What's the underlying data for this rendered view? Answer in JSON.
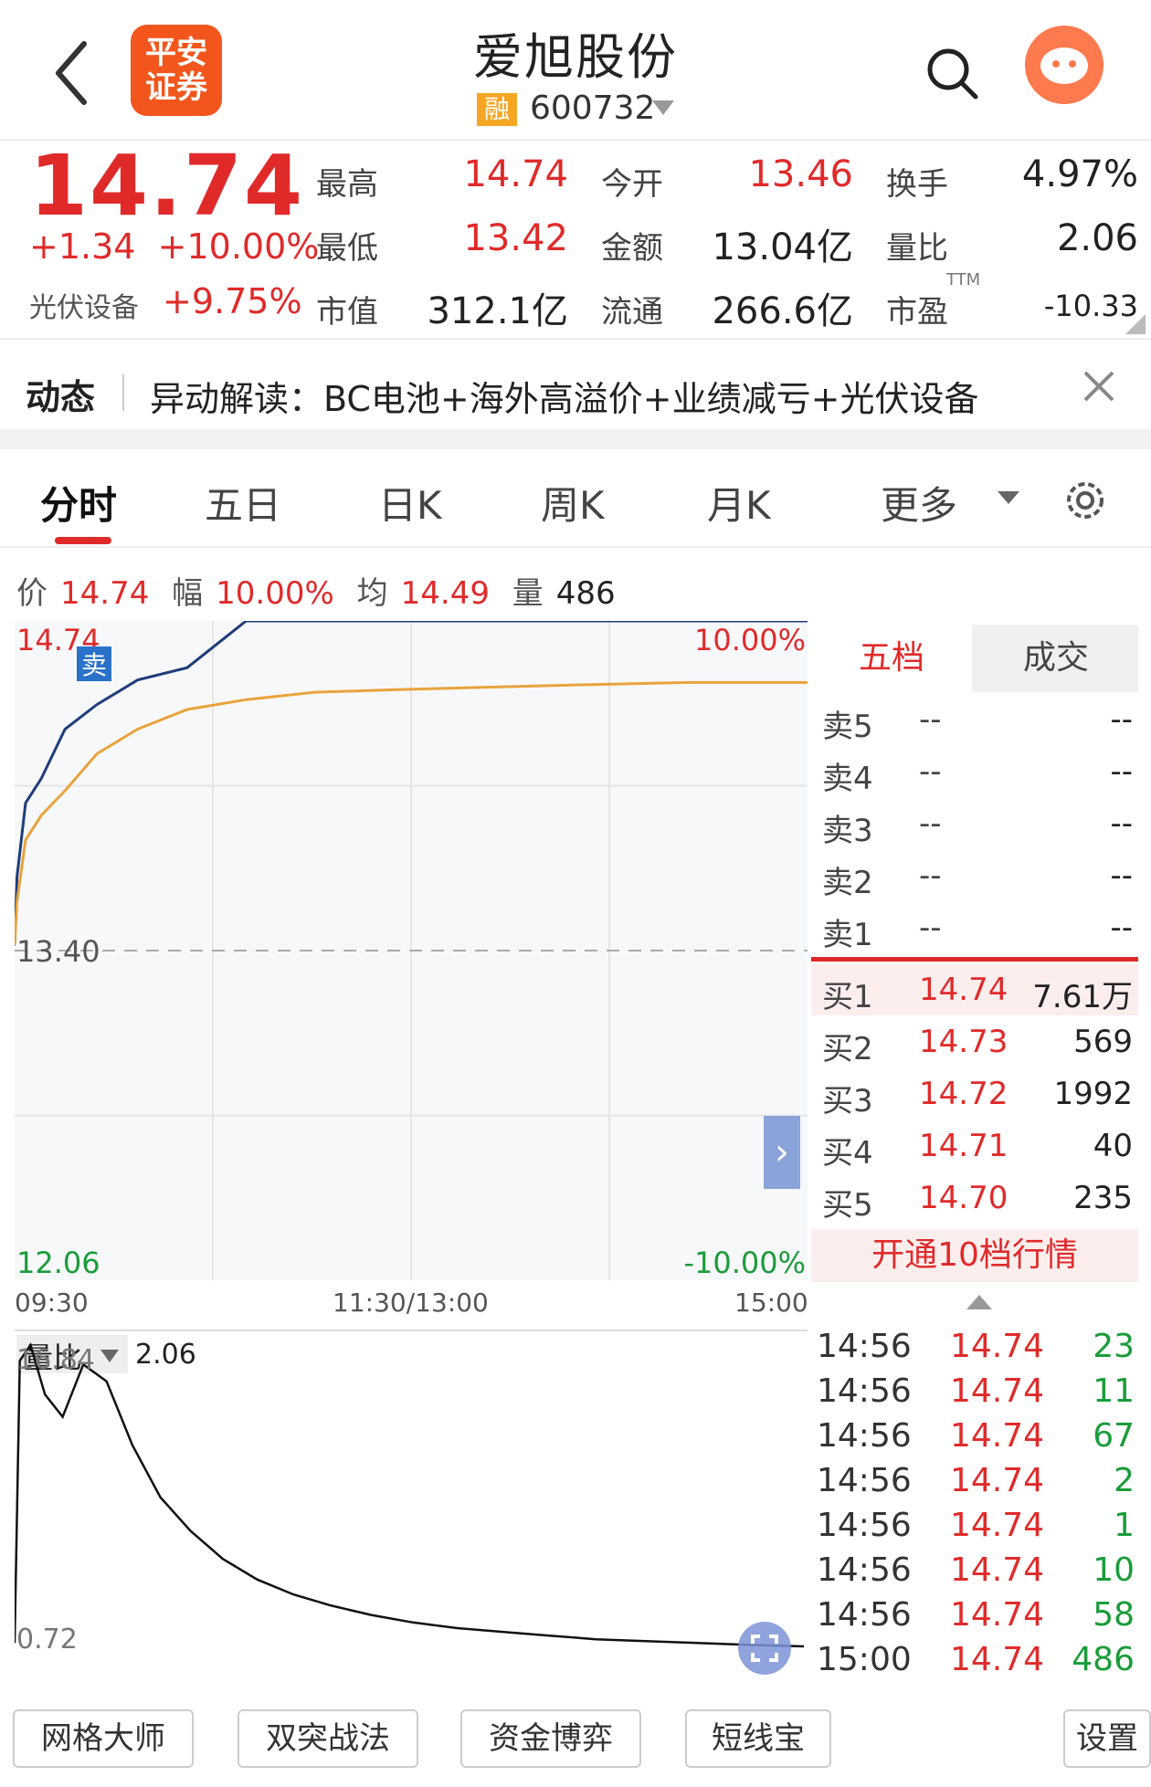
{
  "header": {
    "broker_logo_text": "平安证券",
    "stock_name": "爱旭股份",
    "margin_badge": "融",
    "stock_code": "600732"
  },
  "quote": {
    "price": "14.74",
    "change": "+1.34",
    "change_pct": "+10.00%",
    "sector_name": "光伏设备",
    "sector_change": "+9.75%",
    "fields": [
      {
        "label": "最高",
        "value": "14.74",
        "color": "#e02a2a"
      },
      {
        "label": "今开",
        "value": "13.46",
        "color": "#e02a2a"
      },
      {
        "label": "换手",
        "value": "4.97%",
        "color": "#222222"
      },
      {
        "label": "最低",
        "value": "13.42",
        "color": "#e02a2a"
      },
      {
        "label": "金额",
        "value": "13.04亿",
        "color": "#222222"
      },
      {
        "label": "量比",
        "value": "2.06",
        "color": "#222222"
      },
      {
        "label": "市值",
        "value": "312.1亿",
        "color": "#222222"
      },
      {
        "label": "流通",
        "value": "266.6亿",
        "color": "#222222"
      },
      {
        "label": "市盈",
        "value": "-10.33",
        "color": "#222222"
      }
    ],
    "pe_superscript": "TTM"
  },
  "news": {
    "tag": "动态",
    "text": "异动解读：BC电池+海外高溢价+业绩减亏+光伏设备"
  },
  "tabs": [
    "分时",
    "五日",
    "日K",
    "周K",
    "月K",
    "更多"
  ],
  "info_line": {
    "price_label": "价",
    "price": "14.74",
    "amp_label": "幅",
    "amp": "10.00%",
    "avg_label": "均",
    "avg": "14.49",
    "vol_label": "量",
    "vol": "486"
  },
  "chart_data": [
    {
      "type": "line",
      "title": "",
      "y_labels": {
        "top": "14.74",
        "mid": "13.40",
        "bottom": "12.06",
        "top_pct": "10.00%",
        "bottom_pct": "-10.00%"
      },
      "ylim": [
        12.06,
        14.74
      ],
      "x_labels": [
        "09:30",
        "11:30/13:00",
        "15:00"
      ],
      "sell_marker": "卖",
      "series": [
        {
          "color": "#1f3d7a",
          "values": [
            13.42,
            13.7,
            14.0,
            14.1,
            14.3,
            14.4,
            14.5,
            14.55,
            14.74,
            14.74,
            14.74,
            14.74,
            14.74,
            14.74,
            14.74
          ]
        },
        {
          "color": "#e8a33c",
          "values": [
            13.42,
            13.6,
            13.85,
            13.95,
            14.05,
            14.2,
            14.3,
            14.38,
            14.42,
            14.45,
            14.46,
            14.47,
            14.48,
            14.49,
            14.49
          ]
        }
      ]
    },
    {
      "type": "line",
      "title": "",
      "y_labels": {
        "top": "16.84",
        "bottom": "0.72"
      },
      "ylim": [
        0.72,
        16.84
      ],
      "series": [
        {
          "color": "#111111",
          "values": [
            0.9,
            16.0,
            16.84,
            14.2,
            13.0,
            15.8,
            14.9,
            11.5,
            8.7,
            6.9,
            5.4,
            4.3,
            3.5,
            2.9,
            2.4,
            2.0,
            1.7,
            1.5,
            1.3,
            1.1,
            1.0,
            0.9,
            0.8,
            0.72
          ]
        }
      ]
    }
  ],
  "volume_ratio": {
    "label": "量比",
    "value": "2.06"
  },
  "order_book": {
    "tab_active": "五档",
    "tab_other": "成交",
    "sell": [
      {
        "label": "卖5",
        "price": "--",
        "vol": "--"
      },
      {
        "label": "卖4",
        "price": "--",
        "vol": "--"
      },
      {
        "label": "卖3",
        "price": "--",
        "vol": "--"
      },
      {
        "label": "卖2",
        "price": "--",
        "vol": "--"
      },
      {
        "label": "卖1",
        "price": "--",
        "vol": "--"
      }
    ],
    "buy": [
      {
        "label": "买1",
        "price": "14.74",
        "vol": "7.61万"
      },
      {
        "label": "买2",
        "price": "14.73",
        "vol": "569"
      },
      {
        "label": "买3",
        "price": "14.72",
        "vol": "1992"
      },
      {
        "label": "买4",
        "price": "14.71",
        "vol": "40"
      },
      {
        "label": "买5",
        "price": "14.70",
        "vol": "235"
      }
    ],
    "unlock_label": "开通10档行情"
  },
  "ticks": [
    {
      "time": "14:56",
      "price": "14.74",
      "vol": "23"
    },
    {
      "time": "14:56",
      "price": "14.74",
      "vol": "11"
    },
    {
      "time": "14:56",
      "price": "14.74",
      "vol": "67"
    },
    {
      "time": "14:56",
      "price": "14.74",
      "vol": "2"
    },
    {
      "time": "14:56",
      "price": "14.74",
      "vol": "1"
    },
    {
      "time": "14:56",
      "price": "14.74",
      "vol": "10"
    },
    {
      "time": "14:56",
      "price": "14.74",
      "vol": "58"
    },
    {
      "time": "15:00",
      "price": "14.74",
      "vol": "486"
    }
  ],
  "bottom_buttons": [
    "网格大师",
    "双突战法",
    "资金博弈",
    "短线宝",
    "设置"
  ]
}
